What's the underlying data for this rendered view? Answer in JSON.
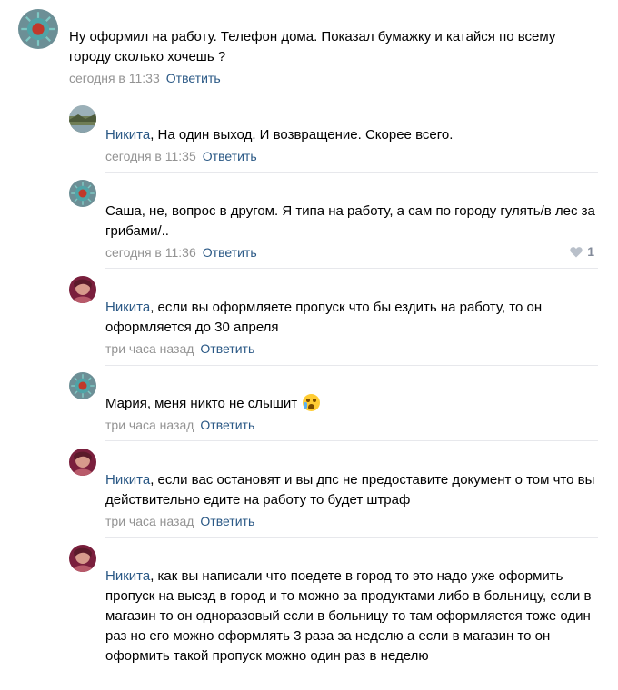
{
  "comments": [
    {
      "author": "",
      "text": "Ну оформил на работу. Телефон дома. Показал бумажку и катайся по всему городу сколько хочешь ?",
      "time": "сегодня в 11:33",
      "reply": "Ответить",
      "avatar": "virus-avatar"
    },
    {
      "author": "Никита",
      "text": ", На один выход. И возвращение. Скорее всего.",
      "time": "сегодня в 11:35",
      "reply": "Ответить",
      "avatar": "landscape-avatar"
    },
    {
      "author": "",
      "text": "Саша, не, вопрос в другом. Я типа на работу, а сам по городу гулять/в лес за грибами/..",
      "time": "сегодня в 11:36",
      "reply": "Ответить",
      "likes": "1",
      "avatar": "virus-avatar"
    },
    {
      "author": "Никита",
      "text": ", если вы оформляете пропуск что бы ездить на работу, то он оформляется до 30 апреля",
      "time": "три часа назад",
      "reply": "Ответить",
      "avatar": "portrait-avatar"
    },
    {
      "author": "",
      "text": "Мария, меня никто не слышит",
      "time": "три часа назад",
      "reply": "Ответить",
      "avatar": "virus-avatar",
      "emoji": "crying-face-emoji"
    },
    {
      "author": "Никита",
      "text": ", если вас остановят и вы дпс не предоставите документ о том что вы действительно едите на работу то будет штраф",
      "time": "три часа назад",
      "reply": "Ответить",
      "avatar": "portrait-avatar"
    },
    {
      "author": "Никита",
      "text": ", как вы написали что поедете в город то это надо уже оформить пропуск на выезд в город и то можно за продуктами либо в больницу, если в магазин то он одноразовый если в больницу то там оформляется тоже один раз но его можно оформлять 3 раза за неделю а если в магазин то он оформить такой пропуск можно один раз в неделю",
      "time": "",
      "reply": "",
      "avatar": "portrait-avatar"
    }
  ],
  "colors": {
    "link": "#2a5885",
    "meta": "#939393",
    "divider": "#e7e8ec",
    "like": "#828a99"
  }
}
